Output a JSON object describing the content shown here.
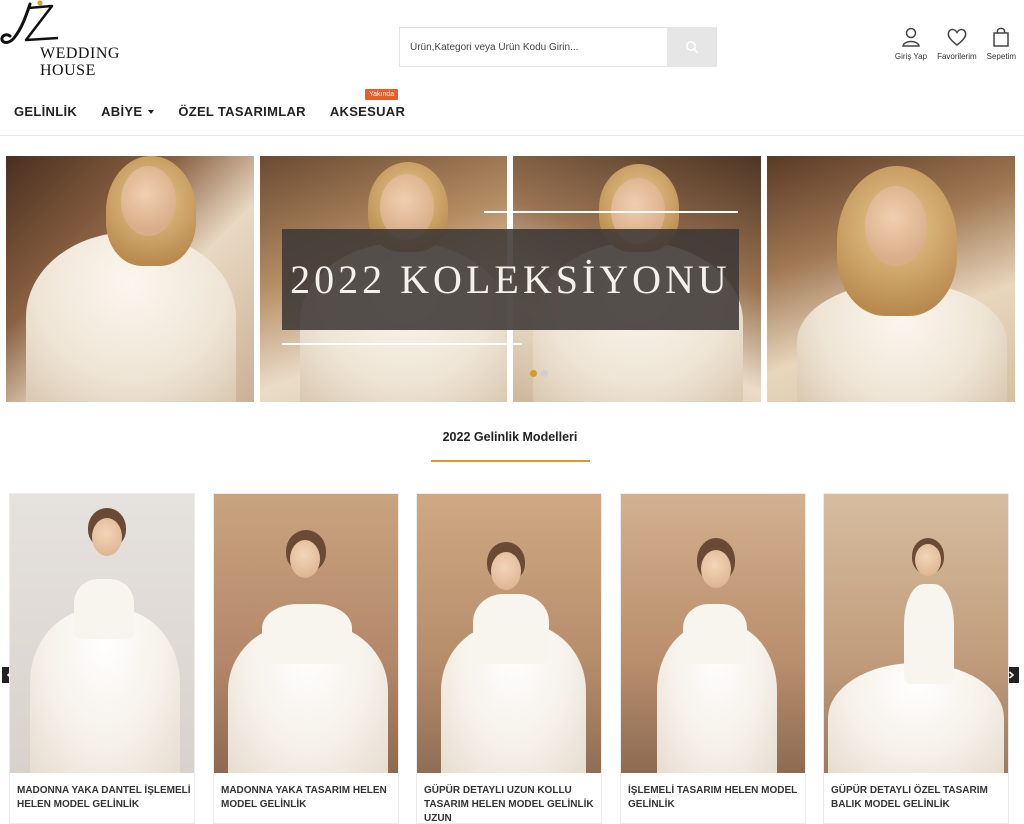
{
  "brand": {
    "mark": "JZ",
    "line1": "WEDDING",
    "line2": "HOUSE"
  },
  "search": {
    "placeholder": "Ürün,Kategori veya Ürün Kodu Girin..."
  },
  "header_icons": [
    {
      "icon": "user-icon",
      "label": "Giriş Yap"
    },
    {
      "icon": "heart-icon",
      "label": "Favorilerim"
    },
    {
      "icon": "cart-icon",
      "label": "Sepetim"
    }
  ],
  "nav": {
    "items": [
      "GELİNLİK",
      "ABİYE",
      "ÖZEL TASARIMLAR",
      "AKSESUAR"
    ],
    "badge": "Yakında"
  },
  "hero": {
    "title": "2022 KOLEKSİYONU",
    "slide_count": 2,
    "active_slide": 1
  },
  "section": {
    "title": "2022 Gelinlik Modelleri"
  },
  "products": [
    {
      "name": "MADONNA YAKA DANTEL İŞLEMELİ HELEN MODEL GELİNLİK"
    },
    {
      "name": "MADONNA YAKA TASARIM HELEN MODEL GELİNLİK"
    },
    {
      "name": "GÜPÜR DETAYLI UZUN KOLLU TASARIM HELEN MODEL GELİNLİK UZUN"
    },
    {
      "name": "İŞLEMELİ TASARIM HELEN MODEL GELİNLİK"
    },
    {
      "name": "GÜPÜR DETAYLI ÖZEL TASARIM BALIK MODEL GELİNLİK"
    }
  ],
  "colors": {
    "accent": "#d79a2b",
    "badge": "#e85d2a",
    "text": "#222222"
  }
}
